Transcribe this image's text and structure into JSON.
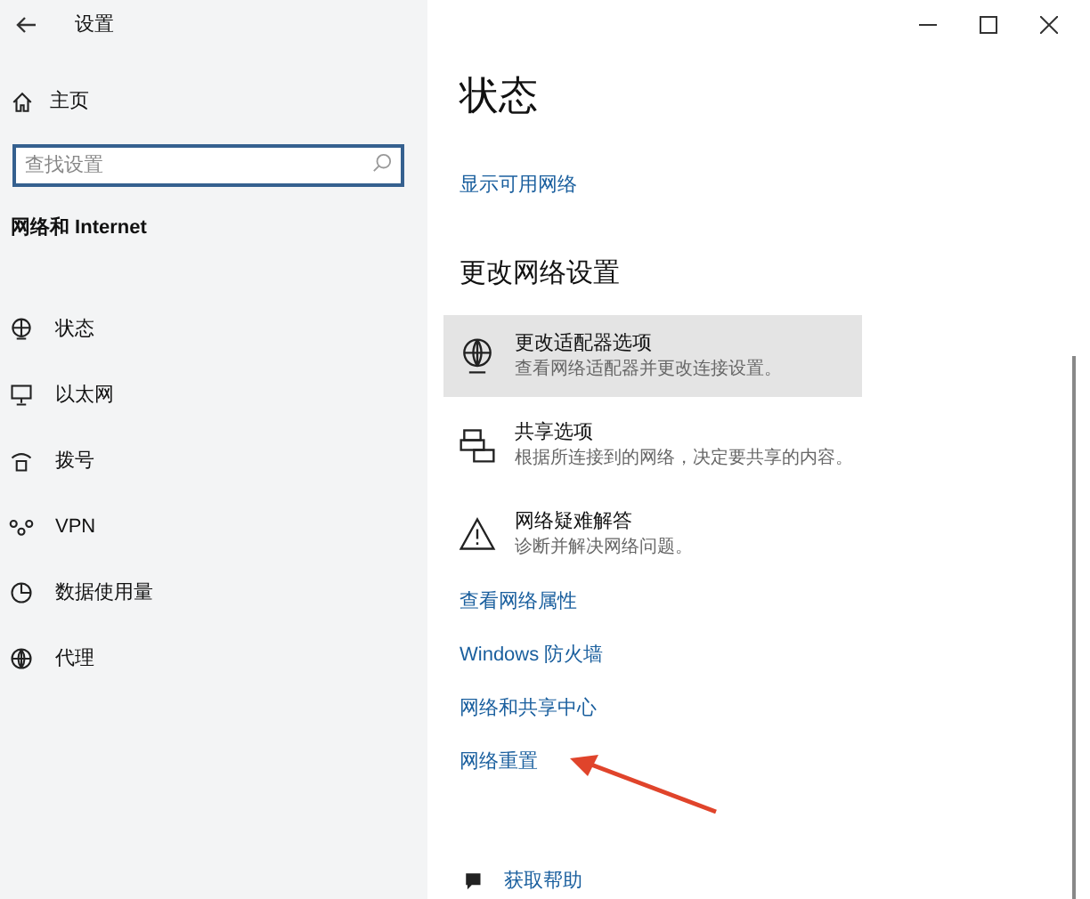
{
  "sidebar": {
    "title": "设置",
    "home": "主页",
    "search": {
      "placeholder": "查找设置"
    },
    "section": "网络和 Internet",
    "items": [
      {
        "label": "状态",
        "kind": "status",
        "selected": false
      },
      {
        "label": "以太网",
        "kind": "ethernet",
        "selected": false
      },
      {
        "label": "拨号",
        "kind": "dialup",
        "selected": false
      },
      {
        "label": "VPN",
        "kind": "vpn",
        "selected": false
      },
      {
        "label": "数据使用量",
        "kind": "data",
        "selected": false
      },
      {
        "label": "代理",
        "kind": "proxy",
        "selected": false
      }
    ]
  },
  "main": {
    "title": "状态",
    "top_link": "显示可用网络",
    "section": "更改网络设置",
    "options": [
      {
        "title": "更改适配器选项",
        "description": "查看网络适配器并更改连接设置。",
        "kind": "adapter",
        "selected": true
      },
      {
        "title": "共享选项",
        "description": "根据所连接到的网络，决定要共享的内容。",
        "kind": "sharing",
        "selected": false
      },
      {
        "title": "网络疑难解答",
        "description": "诊断并解决网络问题。",
        "kind": "warning",
        "selected": false
      }
    ],
    "links": [
      "查看网络属性",
      "Windows 防火墙",
      "网络和共享中心",
      "网络重置"
    ],
    "help": "获取帮助"
  }
}
